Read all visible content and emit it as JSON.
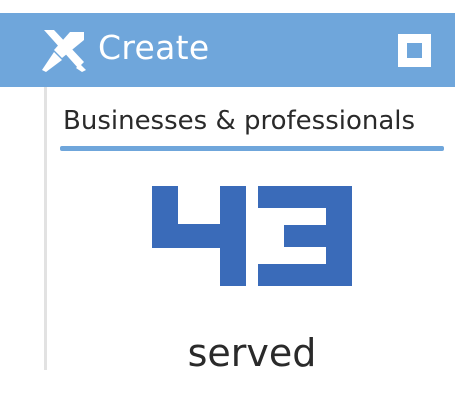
{
  "header": {
    "title": "Create",
    "icon": "tools-icon",
    "background_color": "#6fa6db"
  },
  "section": {
    "title": "Businesses & professionals"
  },
  "stat": {
    "value": "43",
    "label": "served",
    "color": "#3a6bb9"
  }
}
